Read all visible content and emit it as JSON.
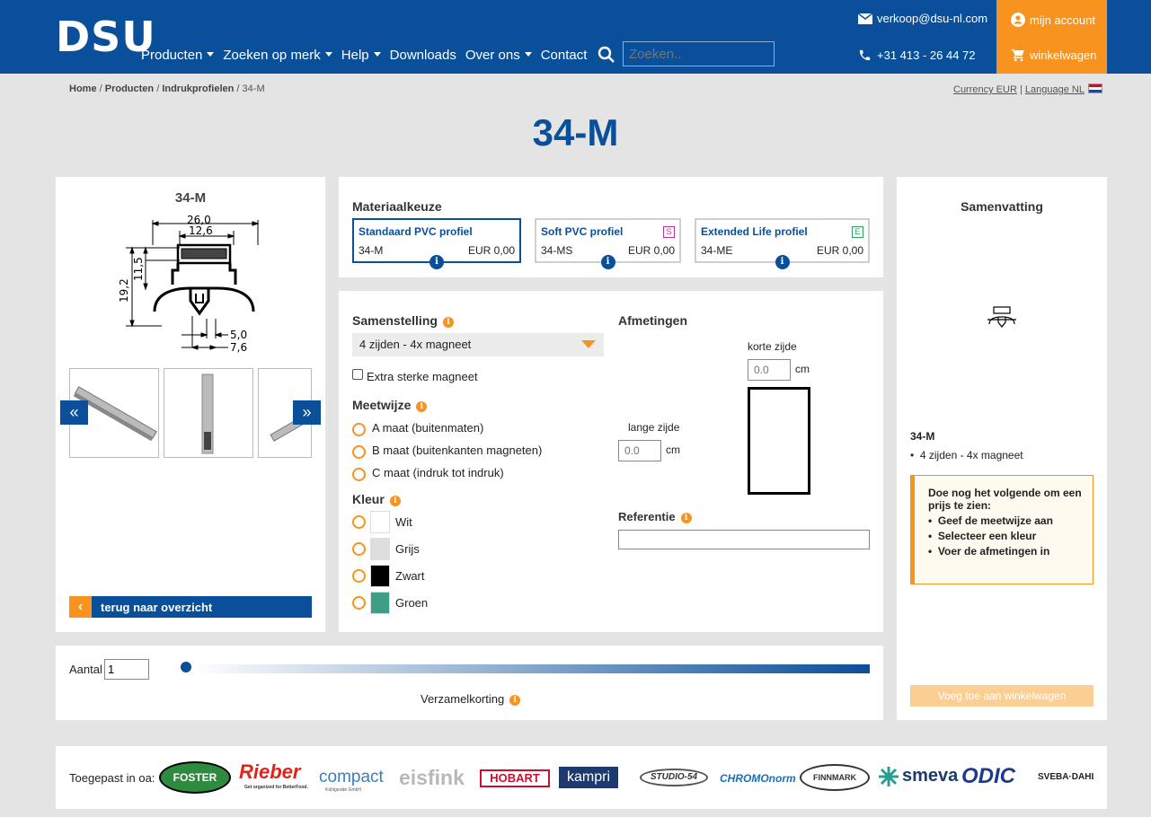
{
  "header": {
    "logo": "DSU",
    "nav": [
      {
        "label": "Producten",
        "dropdown": true
      },
      {
        "label": "Zoeken op merk",
        "dropdown": true
      },
      {
        "label": "Help",
        "dropdown": true
      },
      {
        "label": "Downloads",
        "dropdown": false
      },
      {
        "label": "Over ons",
        "dropdown": true
      },
      {
        "label": "Contact",
        "dropdown": false
      }
    ],
    "search_placeholder": "Zoeken..",
    "email": "verkoop@dsu-nl.com",
    "phone": "+31 413 - 26 44 72",
    "account_label": "mijn account",
    "cart_label": "winkelwagen"
  },
  "breadcrumb": {
    "items": [
      "Home",
      "Producten",
      "Indrukprofielen"
    ],
    "current": "34-M",
    "sep": " / "
  },
  "locale": {
    "currency_label": "Currency EUR",
    "language_label": "Language NL",
    "sep": "|"
  },
  "page_title": "34-M",
  "product": {
    "name": "34-M",
    "dims": {
      "w_outer": "26,0",
      "w_inner": "12,6",
      "h_outer": "19,2",
      "h_inner": "11,5",
      "b1": "5,0",
      "b2": "7,6"
    },
    "back_label": "terug naar overzicht",
    "prev_icon": "«",
    "next_icon": "»"
  },
  "material": {
    "title": "Materiaalkeuze",
    "profiles": [
      {
        "name": "Standaard PVC profiel",
        "code": "34-M",
        "price": "EUR 0,00",
        "badge": "",
        "selected": true
      },
      {
        "name": "Soft PVC profiel",
        "code": "34-MS",
        "price": "EUR 0,00",
        "badge": "S",
        "badge_color": "#c2358f",
        "selected": false
      },
      {
        "name": "Extended Life profiel",
        "code": "34-ME",
        "price": "EUR 0,00",
        "badge": "E",
        "badge_color": "#2e9e5a",
        "selected": false
      }
    ]
  },
  "config": {
    "samenstelling_label": "Samenstelling",
    "samenstelling_value": "4 zijden - 4x magneet",
    "extra_magneet": "Extra sterke magneet",
    "meetwijze_label": "Meetwijze",
    "meetwijze_options": [
      "A maat (buitenmaten)",
      "B maat (buitenkanten magneten)",
      "C maat (indruk tot indruk)"
    ],
    "kleur_label": "Kleur",
    "kleuren": [
      {
        "name": "Wit",
        "color": "#ffffff"
      },
      {
        "name": "Grijs",
        "color": "#dedede"
      },
      {
        "name": "Zwart",
        "color": "#000000"
      },
      {
        "name": "Groen",
        "color": "#3e9e88"
      }
    ],
    "afmetingen_label": "Afmetingen",
    "korte_zijde": "korte zijde",
    "lange_zijde": "lange zijde",
    "placeholder": "0.0",
    "unit": "cm",
    "referentie_label": "Referentie"
  },
  "quantity": {
    "label": "Aantal",
    "value": "1",
    "korting_label": "Verzamelkorting"
  },
  "summary": {
    "title": "Samenvatting",
    "product": "34-M",
    "items": [
      "4 zijden - 4x magneet"
    ],
    "todo_title": "Doe nog het volgende om een prijs te zien:",
    "todo": [
      "Geef de meetwijze aan",
      "Selecteer een kleur",
      "Voer de afmetingen in"
    ],
    "add_button": "Voeg toe aan winkelwagen"
  },
  "brands": {
    "label": "Toegepast in oa:",
    "names": [
      "FOSTER",
      "Rieber",
      "compact",
      "eisfink",
      "HOBART",
      "kampri",
      "STUDIO-54",
      "CHROMOnorm",
      "FINNMARK",
      "smeva",
      "ODIC",
      "SVEBA·DAHLEN"
    ],
    "sub_rieber": "Get organized for BetterFood.",
    "sub_compact": "Kühlgeräte GmbH"
  },
  "colors": {
    "primary": "#0a4f9a",
    "accent": "#f7931e"
  }
}
